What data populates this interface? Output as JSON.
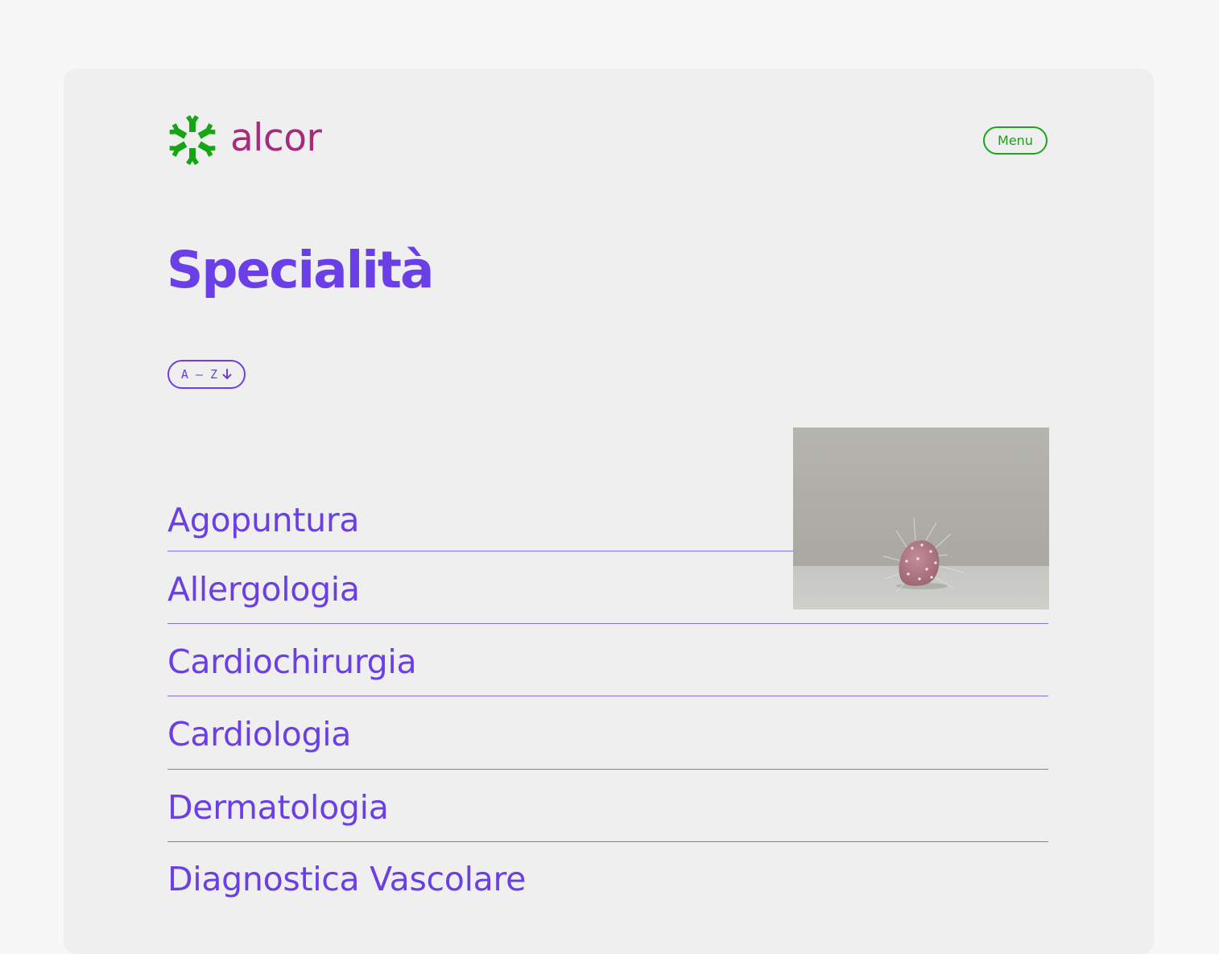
{
  "brand": {
    "name": "alcor",
    "logo_icon": "green-asterisk-logo-icon",
    "name_color": "#a82a7e",
    "icon_color": "#14a614"
  },
  "header": {
    "menu_label": "Menu",
    "menu_color": "#1aa61a"
  },
  "page": {
    "title": "Specialità",
    "accent_color": "#6b3fe6"
  },
  "sort": {
    "label": "A – Z",
    "icon": "arrow-down-icon"
  },
  "specialties": [
    "Agopuntura",
    "Allergologia",
    "Cardiochirurgia",
    "Cardiologia",
    "Dermatologia",
    "Diagnostica Vascolare"
  ],
  "preview_image": {
    "subject": "pink-clay-figure-with-pins-photo"
  }
}
